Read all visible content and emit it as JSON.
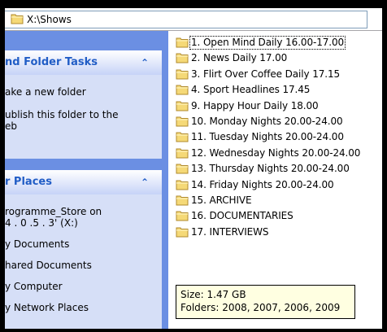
{
  "address_bar": {
    "path": "X:\\Shows"
  },
  "left_pane": {
    "file_folder_tasks": {
      "title": "nd Folder Tasks",
      "items": [
        {
          "line1": "ake a new folder",
          "line2": ""
        },
        {
          "line1": "ublish this folder to the",
          "line2": "eb"
        }
      ]
    },
    "other_places": {
      "title": "r Places",
      "items": [
        {
          "line1": "rogramme_Store on",
          "line2": "4 . 0 .5 . 3' (X:)"
        },
        {
          "line1": "y Documents",
          "line2": ""
        },
        {
          "line1": "hared Documents",
          "line2": ""
        },
        {
          "line1": "y Computer",
          "line2": ""
        },
        {
          "line1": "y Network Places",
          "line2": ""
        }
      ]
    }
  },
  "folders": [
    "1. Open Mind Daily 16.00-17.00",
    "2. News Daily 17.00",
    "3. Flirt Over Coffee Daily 17.15",
    "4. Sport Headlines 17.45",
    "9. Happy Hour Daily 18.00",
    "10. Monday Nights 20.00-24.00",
    "11. Tuesday Nights 20.00-24.00",
    "12. Wednesday Nights 20.00-24.00",
    "13. Thursday Nights 20.00-24.00",
    "14. Friday Nights 20.00-24.00",
    "15. ARCHIVE",
    "16. DOCUMENTARIES",
    "17. INTERVIEWS"
  ],
  "tooltip": {
    "size": "Size: 1.47 GB",
    "folders": "Folders: 2008, 2007, 2006, 2009"
  },
  "colors": {
    "task_pane_bg": "#6b8fe3",
    "panel_bg": "#d6dff7",
    "panel_title": "#215dc6",
    "folder_yellow": "#f5d977",
    "tooltip_bg": "#ffffe1"
  }
}
